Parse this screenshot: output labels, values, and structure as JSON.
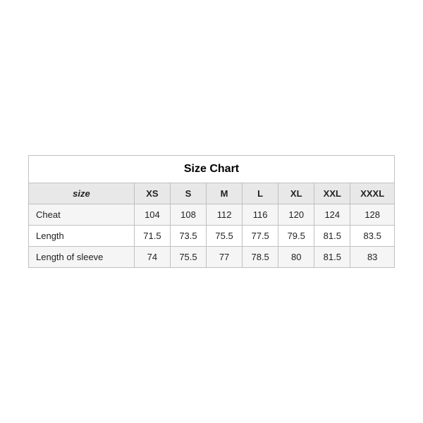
{
  "table": {
    "title": "Size Chart",
    "headers": [
      "size",
      "XS",
      "S",
      "M",
      "L",
      "XL",
      "XXL",
      "XXXL"
    ],
    "rows": [
      {
        "label": "Cheat",
        "values": [
          "104",
          "108",
          "112",
          "116",
          "120",
          "124",
          "128"
        ]
      },
      {
        "label": "Length",
        "values": [
          "71.5",
          "73.5",
          "75.5",
          "77.5",
          "79.5",
          "81.5",
          "83.5"
        ]
      },
      {
        "label": "Length of sleeve",
        "values": [
          "74",
          "75.5",
          "77",
          "78.5",
          "80",
          "81.5",
          "83"
        ]
      }
    ]
  }
}
